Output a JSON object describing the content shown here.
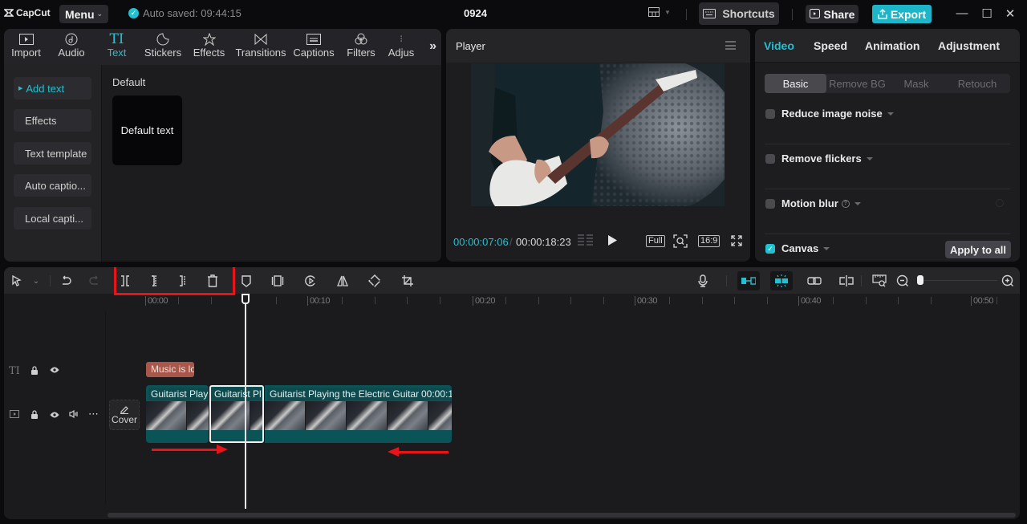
{
  "titlebar": {
    "app_name": "CapCut",
    "menu_label": "Menu",
    "autosave_text": "Auto saved: 09:44:15",
    "project_title": "0924",
    "shortcuts_label": "Shortcuts",
    "share_label": "Share",
    "export_label": "Export",
    "minimize": "—",
    "maximize": "☐",
    "close": "✕"
  },
  "media_tools": [
    {
      "label": "Import",
      "icon": "import-icon",
      "active": false
    },
    {
      "label": "Audio",
      "icon": "audio-icon",
      "active": false
    },
    {
      "label": "Text",
      "icon": "text-icon",
      "active": true
    },
    {
      "label": "Stickers",
      "icon": "stickers-icon",
      "active": false
    },
    {
      "label": "Effects",
      "icon": "effects-icon",
      "active": false
    },
    {
      "label": "Transitions",
      "icon": "transitions-icon",
      "active": false
    },
    {
      "label": "Captions",
      "icon": "captions-icon",
      "active": false
    },
    {
      "label": "Filters",
      "icon": "filters-icon",
      "active": false
    },
    {
      "label": "Adjus",
      "icon": "adjustment-icon",
      "active": false
    }
  ],
  "text_sidebar": {
    "items": [
      {
        "label": "Add text",
        "active": true
      },
      {
        "label": "Effects",
        "active": false
      },
      {
        "label": "Text template",
        "active": false
      },
      {
        "label": "Auto captio...",
        "active": false
      },
      {
        "label": "Local capti...",
        "active": false
      }
    ]
  },
  "text_content": {
    "section_label": "Default",
    "card_label": "Default text"
  },
  "player": {
    "title": "Player",
    "current_time": "00:00:07:06",
    "separator": "/",
    "total_time": "00:00:18:23",
    "full_label": "Full",
    "ratio_label": "16:9"
  },
  "properties": {
    "tabs": [
      {
        "label": "Video",
        "active": true
      },
      {
        "label": "Speed",
        "active": false
      },
      {
        "label": "Animation",
        "active": false
      },
      {
        "label": "Adjustment",
        "active": false
      }
    ],
    "subtabs": [
      {
        "label": "Basic",
        "active": true
      },
      {
        "label": "Remove BG",
        "active": false
      },
      {
        "label": "Mask",
        "active": false
      },
      {
        "label": "Retouch",
        "active": false
      }
    ],
    "options": [
      {
        "label": "Reduce image noise",
        "checked": false
      },
      {
        "label": "Remove flickers",
        "checked": false
      },
      {
        "label": "Motion blur",
        "checked": false
      },
      {
        "label": "Canvas",
        "checked": true
      }
    ],
    "apply_all_label": "Apply to all"
  },
  "timeline": {
    "ruler_labels": [
      "00:00",
      "00:10",
      "00:20",
      "00:30",
      "00:40",
      "00:50"
    ],
    "cover_label": "Cover",
    "text_clip_label": "Music is lo",
    "video_clips": [
      {
        "label": "Guitarist Playi"
      },
      {
        "label": "Guitarist Pl"
      },
      {
        "label": "Guitarist Playing the Electric Guitar",
        "duration": "00:00:1"
      }
    ],
    "zoom_level": 0.05
  },
  "colors": {
    "accent": "#22c1d1",
    "clip_teal": "#0a5458",
    "text_clip": "#a9574a",
    "annotation_red": "#e8141a"
  }
}
